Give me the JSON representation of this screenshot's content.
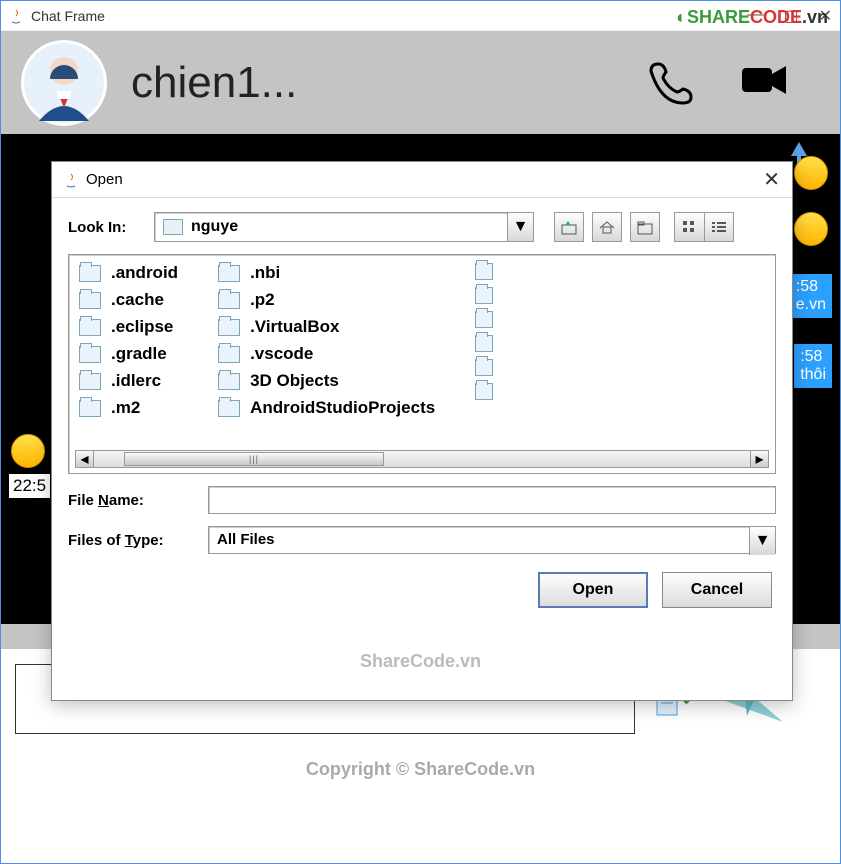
{
  "window": {
    "title": "Chat Frame"
  },
  "watermark": {
    "logo_share": "SHARE",
    "logo_code": "CODE",
    "logo_vn": ".vn",
    "mid": "ShareCode.vn"
  },
  "header": {
    "contact_name": "chien1..."
  },
  "chat": {
    "emoji1": "😄",
    "bubble1_time": ":58",
    "bubble1_text": "e.vn",
    "bubble2_time": ":58",
    "bubble2_text": "thôi",
    "heart_emoji": "😍",
    "time_label": "22:5"
  },
  "copyright": "Copyright © ShareCode.vn",
  "dialog": {
    "title": "Open",
    "lookin_label": "Look In:",
    "lookin_value": "nguye",
    "files_col1": [
      ".android",
      ".cache",
      ".eclipse",
      ".gradle",
      ".idlerc",
      ".m2"
    ],
    "files_col2": [
      ".nbi",
      ".p2",
      ".VirtualBox",
      ".vscode",
      "3D Objects",
      "AndroidStudioProjects"
    ],
    "filename_label_pre": "File ",
    "filename_label_u": "N",
    "filename_label_post": "ame:",
    "filename_value": "",
    "filetype_label_pre": "Files of ",
    "filetype_label_u": "T",
    "filetype_label_post": "ype:",
    "filetype_value": "All Files",
    "open_btn": "Open",
    "cancel_btn": "Cancel"
  }
}
